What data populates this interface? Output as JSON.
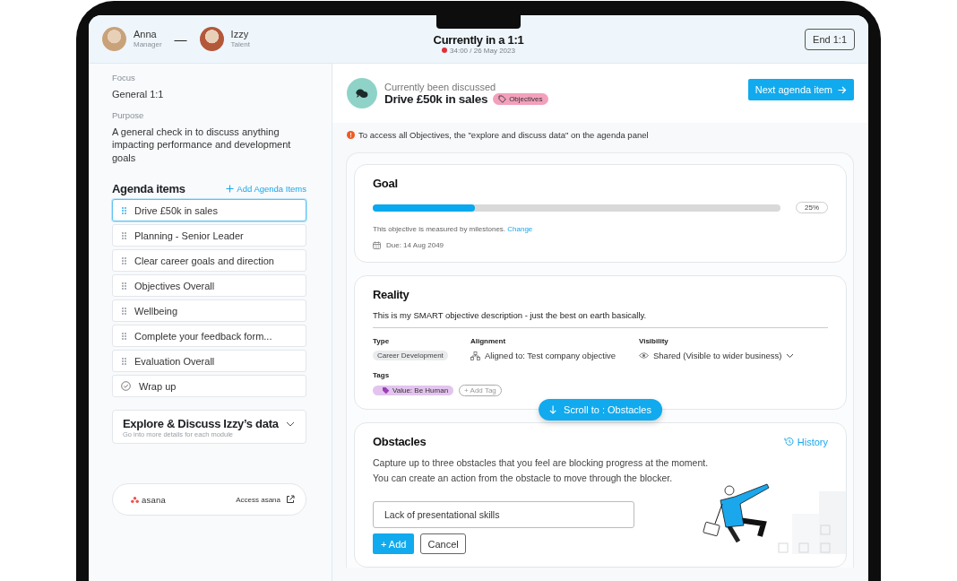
{
  "header": {
    "participants": [
      {
        "name": "Anna",
        "role": "Manager"
      },
      {
        "name": "Izzy",
        "role": "Talent"
      }
    ],
    "separator": "—",
    "title": "Currently in a 1:1",
    "timer": "34:00 / 26 May 2023",
    "end_button": "End 1:1"
  },
  "sidebar": {
    "focus_label": "Focus",
    "focus": "General 1:1",
    "purpose_label": "Purpose",
    "purpose": "A general check in to discuss anything impacting performance and development goals",
    "agenda_title": "Agenda items",
    "add_agenda": "Add Agenda Items",
    "agenda_items": [
      {
        "label": "Drive £50k in sales",
        "kind": "drag",
        "selected": true
      },
      {
        "label": "Planning - Senior Leader",
        "kind": "drag",
        "selected": false
      },
      {
        "label": "Clear career goals and direction",
        "kind": "drag",
        "selected": false
      },
      {
        "label": "Objectives Overall",
        "kind": "drag",
        "selected": false
      },
      {
        "label": "Wellbeing",
        "kind": "drag",
        "selected": false
      },
      {
        "label": "Complete your feedback form...",
        "kind": "drag",
        "selected": false
      },
      {
        "label": "Evaluation Overall",
        "kind": "drag",
        "selected": false
      },
      {
        "label": "Wrap up",
        "kind": "check",
        "selected": false
      }
    ],
    "explore": {
      "title": "Explore & Discuss Izzy’s data",
      "subtitle": "Go into more details for each module"
    },
    "integration": {
      "logo_text": "asana",
      "link": "Access asana"
    }
  },
  "discussion": {
    "caption": "Currently been discussed",
    "title": "Drive £50k in sales",
    "tag": "Objectives",
    "next_button": "Next agenda item"
  },
  "notice": "To access all Objectives, the \"explore and discuss data\" on the agenda panel",
  "goal": {
    "title": "Goal",
    "level": 0.25,
    "reading": "25%",
    "measure_text": "This objective is measured by milestones.",
    "change_link": "Change",
    "due": "Due: 14 Aug 2049"
  },
  "reality": {
    "title": "Reality",
    "description": "This is my SMART objective description - just the best on earth basically.",
    "type_label": "Type",
    "type": "Career Development",
    "alignment_label": "Alignment",
    "alignment": "Aligned to: Test company objective",
    "visibility_label": "Visibility",
    "visibility": "Shared (Visible to wider business)",
    "tags_label": "Tags",
    "tags": [
      "Value: Be Human"
    ],
    "add_tag": "+ Add Tag"
  },
  "scroll_button": "Scroll to : Obstacles",
  "obstacles": {
    "title": "Obstacles",
    "history": "History",
    "description_lines": [
      "Capture up to three obstacles that you feel are blocking progress at the moment.",
      "You can create an action from the obstacle to move through the blocker."
    ],
    "input": {
      "value": "Lack of presentational skills"
    },
    "add_button": "+ Add",
    "cancel_button": "Cancel"
  }
}
